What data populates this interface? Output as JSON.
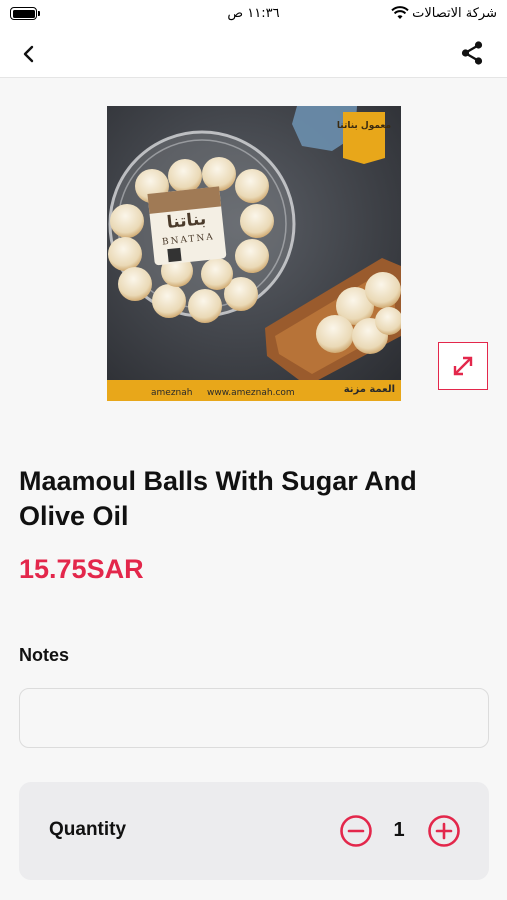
{
  "status_bar": {
    "carrier": "شركة الاتصالات",
    "time": "١١:٣٦ ص"
  },
  "nav": {
    "back_icon": "chevron-left-icon",
    "share_icon": "share-icon"
  },
  "product": {
    "image_brand_ar": "بناتنا",
    "image_brand_en": "BNATNA",
    "image_badge_ar": "معمول بناتنا",
    "image_footer_handle": "ameznah",
    "image_footer_site": "www.ameznah.com",
    "image_footer_brand_ar": "العمة مزنة",
    "name": "Maamoul Balls With Sugar And Olive Oil",
    "price": "15.75SAR",
    "expand_icon": "expand-arrows-icon"
  },
  "notes": {
    "label": "Notes",
    "value": "",
    "placeholder": ""
  },
  "quantity": {
    "label": "Quantity",
    "value": "1",
    "minus_icon": "minus-circle-icon",
    "plus_icon": "plus-circle-icon"
  },
  "colors": {
    "accent": "#e3274b",
    "background": "#f7f7f7",
    "card": "#ececee"
  }
}
